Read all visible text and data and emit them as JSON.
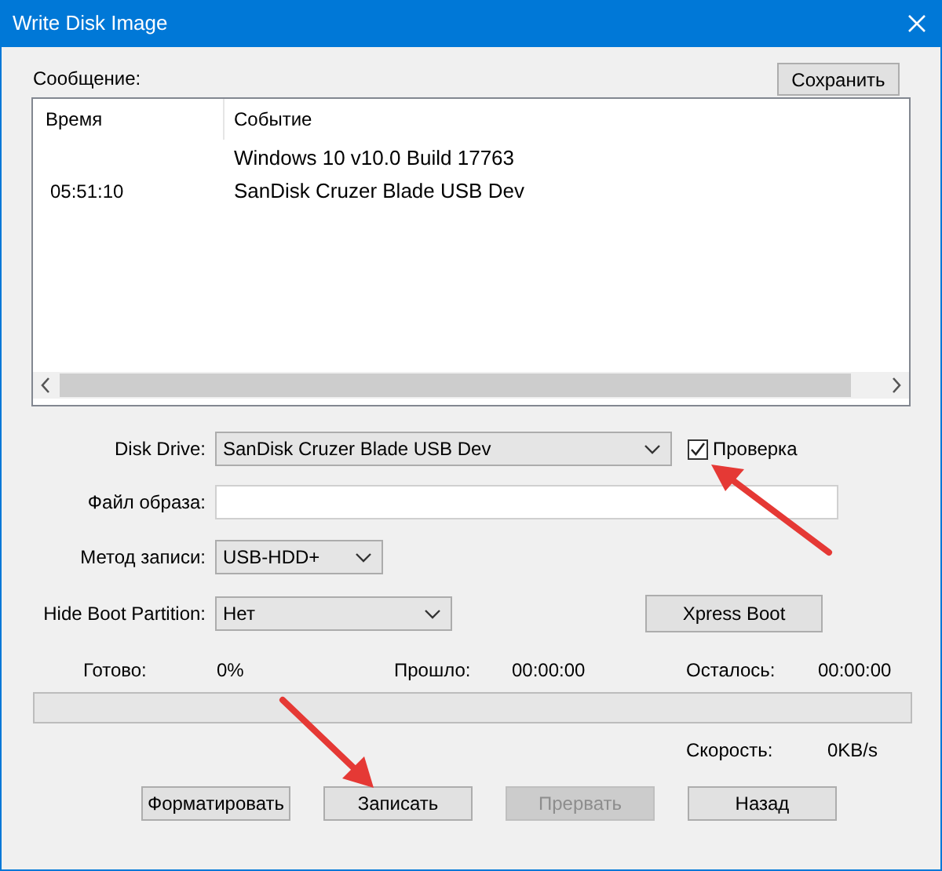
{
  "window": {
    "title": "Write Disk Image"
  },
  "log": {
    "label": "Сообщение:",
    "save_button": "Сохранить",
    "columns": [
      "Время",
      "Событие"
    ],
    "rows": [
      {
        "event": "Windows 10 v10.0 Build 17763"
      },
      {
        "time": "05:51:10",
        "event": "SanDisk Cruzer Blade USB Dev"
      }
    ]
  },
  "disk_drive": {
    "label": "Disk Drive:",
    "value": "SanDisk Cruzer Blade USB Dev"
  },
  "verify": {
    "label": "Проверка",
    "checked": true
  },
  "image_file": {
    "label": "Файл образа:"
  },
  "write_method": {
    "label": "Метод записи:",
    "value": "USB-HDD+"
  },
  "hide_boot": {
    "label": "Hide Boot Partition:",
    "value": "Нет"
  },
  "xpress_boot": {
    "label": "Xpress Boot",
    "disabled": false
  },
  "status": [
    {
      "label": "Готово:",
      "value": "0%"
    },
    {
      "label": "Прошло:",
      "value": "00:00:00"
    },
    {
      "label": "Осталось:",
      "value": "00:00:00"
    }
  ],
  "progress": {
    "level": 0
  },
  "speed": {
    "label": "Скорость:",
    "value": "0KB/s"
  },
  "buttons": [
    {
      "label": "Форматировать",
      "disabled": false
    },
    {
      "label": "Записать",
      "disabled": false
    },
    {
      "label": "Прервать",
      "disabled": true
    },
    {
      "label": "Назад",
      "disabled": false
    }
  ]
}
